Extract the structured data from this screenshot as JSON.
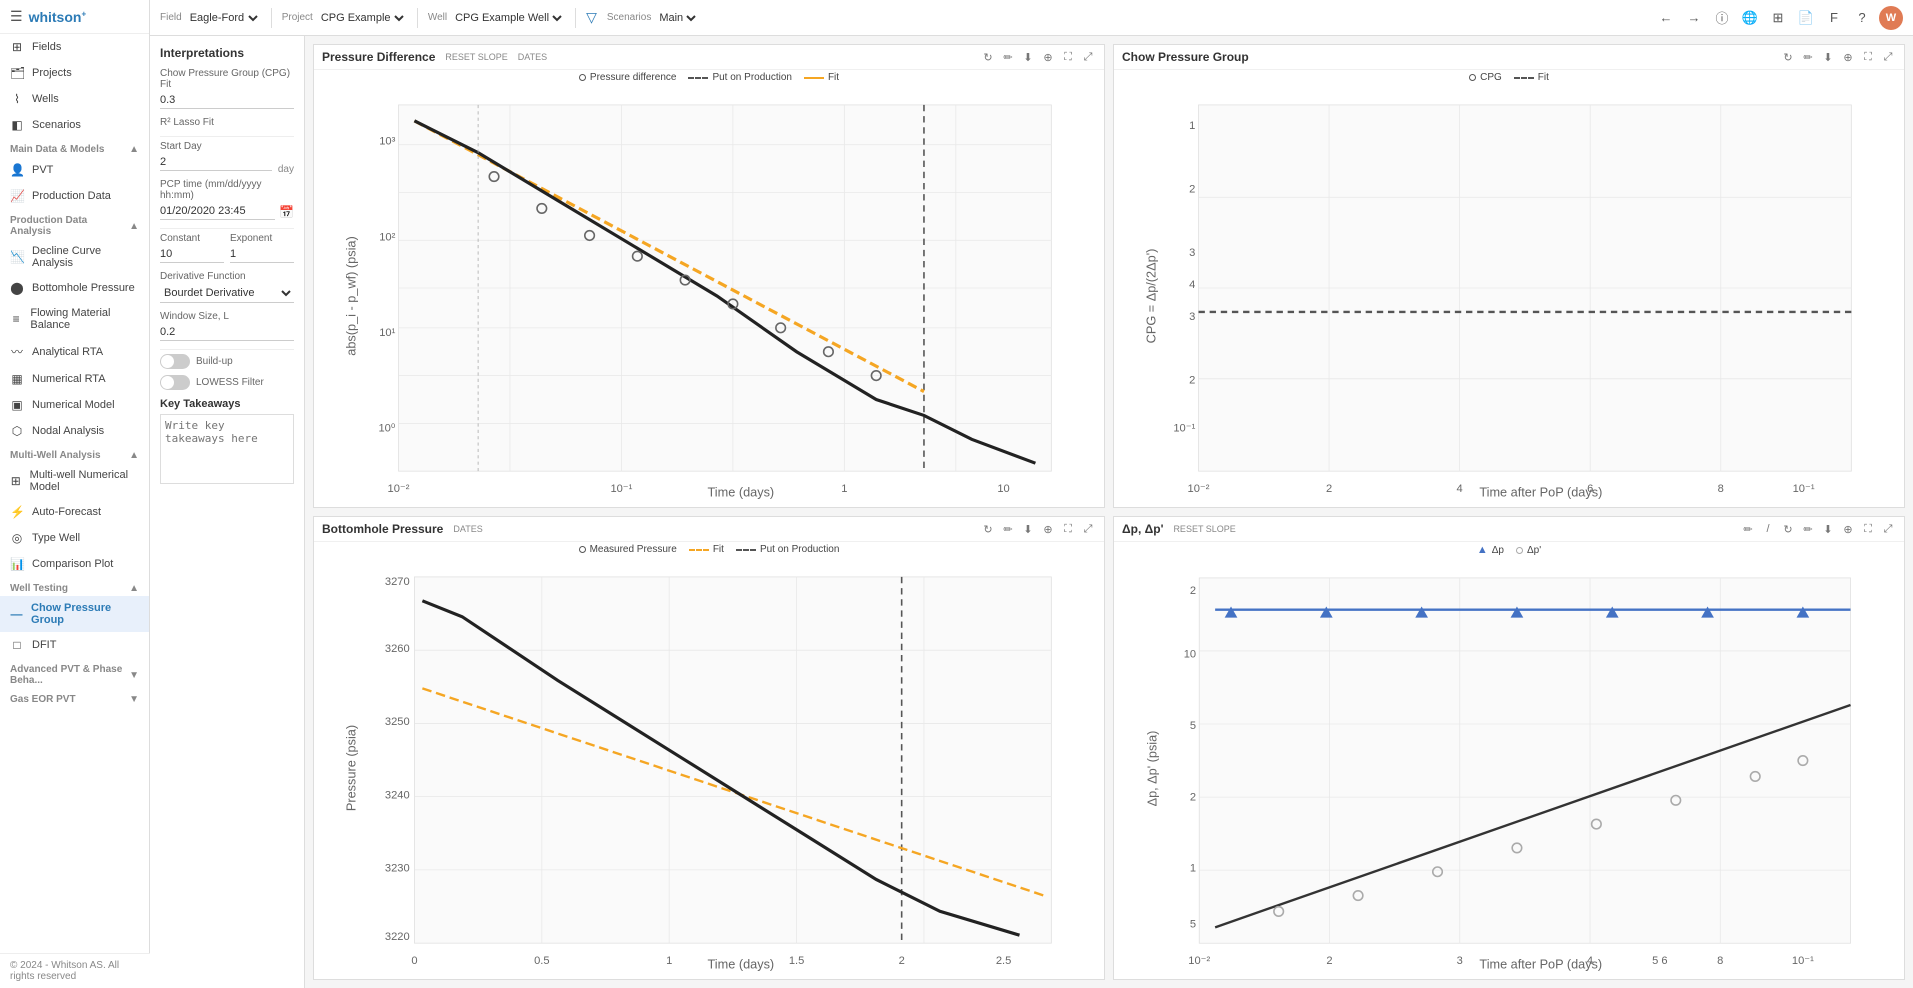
{
  "brand": "whitson",
  "topbar": {
    "field_label": "Field",
    "field_value": "Eagle-Ford",
    "project_label": "Project",
    "project_value": "CPG Example",
    "well_label": "Well",
    "well_value": "CPG Example Well",
    "scenarios_label": "Scenarios",
    "scenarios_value": "Main"
  },
  "sidebar": {
    "items": [
      {
        "id": "fields",
        "label": "Fields",
        "icon": "⊞"
      },
      {
        "id": "projects",
        "label": "Projects",
        "icon": "📁"
      },
      {
        "id": "wells",
        "label": "Wells",
        "icon": "⌇"
      },
      {
        "id": "scenarios",
        "label": "Scenarios",
        "icon": "◧"
      }
    ],
    "sections": [
      {
        "title": "Main Data & Models",
        "items": [
          {
            "id": "pvt",
            "label": "PVT",
            "icon": "👤"
          },
          {
            "id": "production-data",
            "label": "Production Data",
            "icon": "📈"
          }
        ]
      },
      {
        "title": "Production Data Analysis",
        "items": [
          {
            "id": "decline-curve",
            "label": "Decline Curve Analysis",
            "icon": "📉"
          },
          {
            "id": "bottomhole",
            "label": "Bottomhole Pressure",
            "icon": "⬤"
          },
          {
            "id": "flowing-material",
            "label": "Flowing Material Balance",
            "icon": "≡"
          },
          {
            "id": "analytical-rta",
            "label": "Analytical RTA",
            "icon": "〰"
          },
          {
            "id": "numerical-rta",
            "label": "Numerical RTA",
            "icon": "▦"
          },
          {
            "id": "numerical-model",
            "label": "Numerical Model",
            "icon": "▣"
          },
          {
            "id": "nodal-analysis",
            "label": "Nodal Analysis",
            "icon": "⬡"
          }
        ]
      },
      {
        "title": "Multi-Well Analysis",
        "items": [
          {
            "id": "multi-well-numerical",
            "label": "Multi-well Numerical Model",
            "icon": "⊞"
          },
          {
            "id": "auto-forecast",
            "label": "Auto-Forecast",
            "icon": "⚡"
          },
          {
            "id": "type-well",
            "label": "Type Well",
            "icon": "◎"
          },
          {
            "id": "comparison-plot",
            "label": "Comparison Plot",
            "icon": "📊"
          }
        ]
      },
      {
        "title": "Well Testing",
        "items": [
          {
            "id": "chow-pressure-group",
            "label": "Chow Pressure Group",
            "icon": "—",
            "active": true
          },
          {
            "id": "dfit",
            "label": "DFIT",
            "icon": "□"
          }
        ]
      },
      {
        "title": "Advanced PVT & Phase Beha...",
        "collapsed": true
      },
      {
        "title": "Gas EOR PVT",
        "collapsed": true
      }
    ]
  },
  "left_panel": {
    "title": "Interpretations",
    "cpg_fit_label": "Chow Pressure Group (CPG) Fit",
    "cpg_fit_value": "0.3",
    "lasso_fit_label": "R² Lasso Fit",
    "start_day_label": "Start Day",
    "start_day_value": "2",
    "start_day_unit": "day",
    "pcp_time_label": "PCP time (mm/dd/yyyy hh:mm)",
    "pcp_time_value": "01/20/2020 23:45",
    "constant_label": "Constant",
    "constant_value": "10",
    "exponent_label": "Exponent",
    "exponent_value": "1",
    "derivative_label": "Derivative Function",
    "derivative_value": "Bourdet Derivative",
    "window_size_label": "Window Size, L",
    "window_size_value": "0.2",
    "buildup_label": "Build-up",
    "lowess_label": "LOWESS Filter",
    "key_takeaways_title": "Key Takeaways",
    "key_takeaways_placeholder": "Write key takeaways here"
  },
  "charts": {
    "pressure_difference": {
      "title": "Pressure Difference",
      "action1": "RESET SLOPE",
      "action2": "DATES",
      "legend": [
        {
          "type": "dot",
          "label": "Pressure difference"
        },
        {
          "type": "dashed",
          "label": "Put on Production",
          "color": "#666"
        },
        {
          "type": "line",
          "label": "Fit",
          "color": "#f5a623"
        }
      ],
      "xaxis": "Time (days)",
      "yaxis": "abs(p_i - p_wf) (psia)"
    },
    "chow_pressure_group": {
      "title": "Chow Pressure Group",
      "legend": [
        {
          "type": "dot",
          "label": "CPG"
        },
        {
          "type": "dashed",
          "label": "Fit",
          "color": "#666"
        }
      ],
      "xaxis": "Time after PoP (days)",
      "yaxis": "CPG = Δp/(2Δp')"
    },
    "bottomhole_pressure": {
      "title": "Bottomhole Pressure",
      "action1": "DATES",
      "legend": [
        {
          "type": "dot",
          "label": "Measured Pressure"
        },
        {
          "type": "dashed",
          "label": "Fit",
          "color": "#f5a623"
        },
        {
          "type": "dashed",
          "label": "Put on Production",
          "color": "#666"
        }
      ],
      "xaxis": "Time (days)",
      "yaxis": "Pressure (psia)",
      "ymin": "3220",
      "ymax": "3270"
    },
    "delta_pressure": {
      "title": "Δp, Δp'",
      "action1": "RESET SLOPE",
      "legend": [
        {
          "type": "triangle",
          "label": "Δp",
          "color": "#4472c4"
        },
        {
          "type": "dot",
          "label": "Δp'",
          "color": "#aaa"
        }
      ],
      "xaxis": "Time after PoP (days)",
      "yaxis": "Δp, Δp' (psia)"
    }
  },
  "footer": "© 2024 - Whitson AS. All rights reserved"
}
